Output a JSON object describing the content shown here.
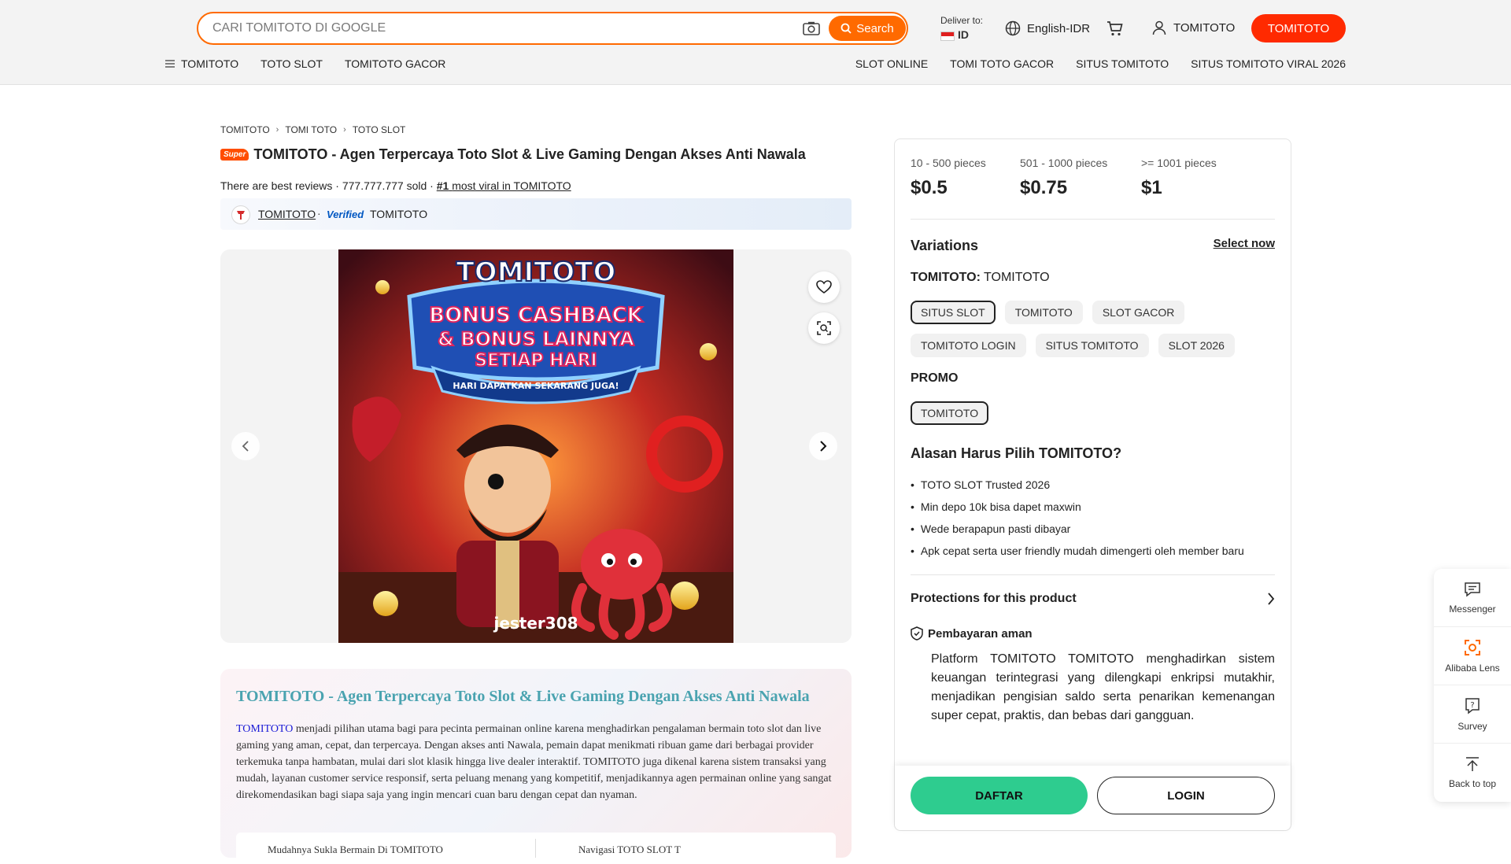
{
  "header": {
    "search_placeholder": "CARI TOMITOTO DI GOOGLE",
    "search_button": "Search",
    "deliver_label": "Deliver to:",
    "deliver_country": "ID",
    "language": "English-IDR",
    "user_label": "TOMITOTO",
    "cta_label": "TOMITOTO",
    "accent_color": "#ff6a00",
    "cta_color": "#ff2a00"
  },
  "nav": {
    "left": [
      "TOMITOTO",
      "TOTO SLOT",
      "TOMITOTO GACOR"
    ],
    "right": [
      "SLOT ONLINE",
      "TOMI TOTO GACOR",
      "SITUS TOMITOTO",
      "SITUS TOMITOTO VIRAL 2026"
    ]
  },
  "breadcrumb": [
    "TOMITOTO",
    "TOMI TOTO",
    "TOTO SLOT"
  ],
  "product": {
    "badge": "Super",
    "title": "TOMITOTO - Agen Terpercaya Toto Slot & Live Gaming Dengan Akses Anti Nawala",
    "reviews": "There are best reviews",
    "sold": "777.777.777 sold",
    "rank_prefix": "#1",
    "rank_text": "most viral in TOMITOTO",
    "store_name": "TOMITOTO",
    "verified_label": "Verified",
    "verified_name": "TOMITOTO"
  },
  "image": {
    "headline": "TOMITOTO",
    "line1": "BONUS CASHBACK",
    "line2": "& BONUS LAINNYA",
    "line3": "SETIAP HARI",
    "ribbon": "HARI DAPATKAN SEKARANG JUGA!",
    "watermark": "jester308"
  },
  "description": {
    "title": "TOMITOTO - Agen Terpercaya Toto Slot & Live Gaming Dengan Akses Anti Nawala",
    "link_word": "TOMITOTO",
    "body": " menjadi pilihan utama bagi para pecinta permainan online karena menghadirkan pengalaman bermain toto slot dan live gaming yang aman, cepat, dan terpercaya. Dengan akses anti Nawala, pemain dapat menikmati ribuan game dari berbagai provider terkemuka tanpa hambatan, mulai dari slot klasik hingga live dealer interaktif. TOMITOTO juga dikenal karena sistem transaksi yang mudah, layanan customer service responsif, serta peluang menang yang kompetitif, menjadikannya agen permainan online yang sangat direkomendasikan bagi siapa saja yang ingin mencari cuan baru dengan cepat dan nyaman.",
    "tab1": "Mudahnya Sukla Bermain Di TOMITOTO",
    "tab2": "Navigasi TOTO SLOT T"
  },
  "pricing": [
    {
      "range": "10 - 500 pieces",
      "price": "$0.5"
    },
    {
      "range": "501 - 1000 pieces",
      "price": "$0.75"
    },
    {
      "range": ">= 1001 pieces",
      "price": "$1"
    }
  ],
  "variations": {
    "title": "Variations",
    "select_now": "Select now",
    "label_key": "TOMITOTO:",
    "label_value": "TOMITOTO",
    "chips": [
      "SITUS SLOT",
      "TOMITOTO",
      "SLOT GACOR",
      "TOMITOTO LOGIN",
      "SITUS TOMITOTO",
      "SLOT 2026"
    ],
    "promo_title": "PROMO",
    "promo_chips": [
      "TOMITOTO"
    ]
  },
  "why": {
    "title": "Alasan Harus Pilih TOMITOTO?",
    "items": [
      "TOTO SLOT Trusted 2026",
      "Min depo 10k bisa dapet maxwin",
      "Wede berapapun pasti dibayar",
      "Apk cepat serta user friendly mudah dimengerti oleh member baru"
    ]
  },
  "protection": {
    "title": "Protections for this product",
    "pay_title": "Pembayaran aman",
    "pay_body": "Platform TOMITOTO TOMITOTO menghadirkan sistem keuangan terintegrasi yang dilengkapi enkripsi mutakhir, menjadikan pengisian saldo serta penarikan kemenangan super cepat, praktis, dan bebas dari gangguan."
  },
  "actions": {
    "daftar": "DAFTAR",
    "login": "LOGIN",
    "daftar_color": "#2ecc8f"
  },
  "sidetools": [
    "Messenger",
    "Alibaba Lens",
    "Survey",
    "Back to top"
  ]
}
